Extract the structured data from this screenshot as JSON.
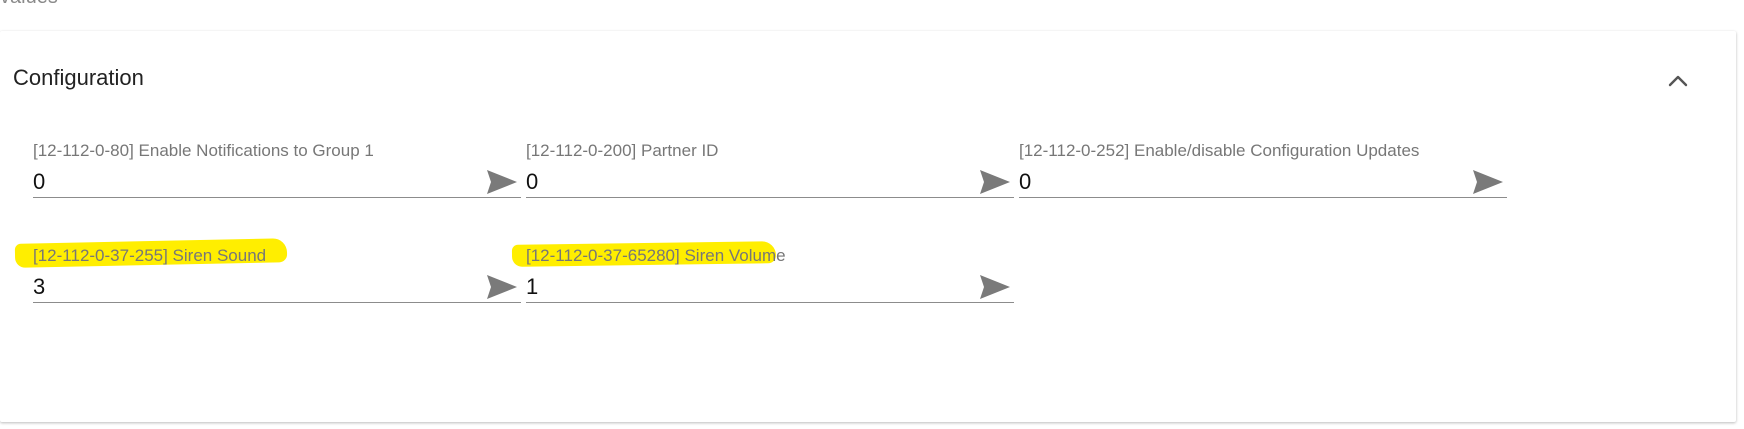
{
  "section_above": {
    "label": "values"
  },
  "configuration": {
    "title": "Configuration",
    "fields": [
      {
        "label": "[12-112-0-80] Enable Notifications to Group 1",
        "value": "0"
      },
      {
        "label": "[12-112-0-200] Partner ID",
        "value": "0"
      },
      {
        "label": "[12-112-0-252] Enable/disable Configuration Updates",
        "value": "0"
      },
      {
        "label": "[12-112-0-37-255] Siren Sound",
        "value": "3"
      },
      {
        "label": "[12-112-0-37-65280] Siren Volume",
        "value": "1"
      }
    ]
  },
  "colors": {
    "highlight": "#ffee00",
    "icon": "#7a7a7a"
  }
}
